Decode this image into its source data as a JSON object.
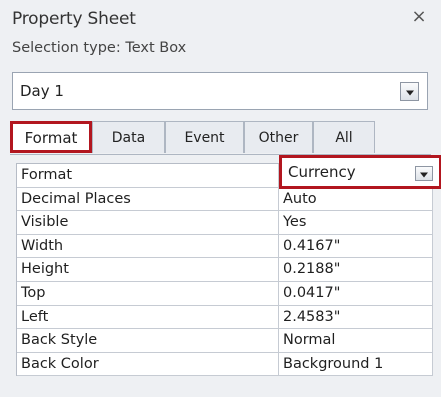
{
  "title": "Property Sheet",
  "close_glyph": "×",
  "selection_type": "Selection type:  Text Box",
  "object_selector": {
    "value": "Day 1"
  },
  "tabs": [
    "Format",
    "Data",
    "Event",
    "Other",
    "All"
  ],
  "active_tab": "Format",
  "properties": [
    {
      "name": "Format",
      "value": "Currency"
    },
    {
      "name": "Decimal Places",
      "value": "Auto"
    },
    {
      "name": "Visible",
      "value": "Yes"
    },
    {
      "name": "Width",
      "value": "0.4167\""
    },
    {
      "name": "Height",
      "value": "0.2188\""
    },
    {
      "name": "Top",
      "value": "0.0417\""
    },
    {
      "name": "Left",
      "value": "2.4583\""
    },
    {
      "name": "Back Style",
      "value": "Normal"
    },
    {
      "name": "Back Color",
      "value": "Background 1"
    }
  ],
  "colors": {
    "highlight": "#b2161f",
    "panel": "#eef0f3"
  }
}
